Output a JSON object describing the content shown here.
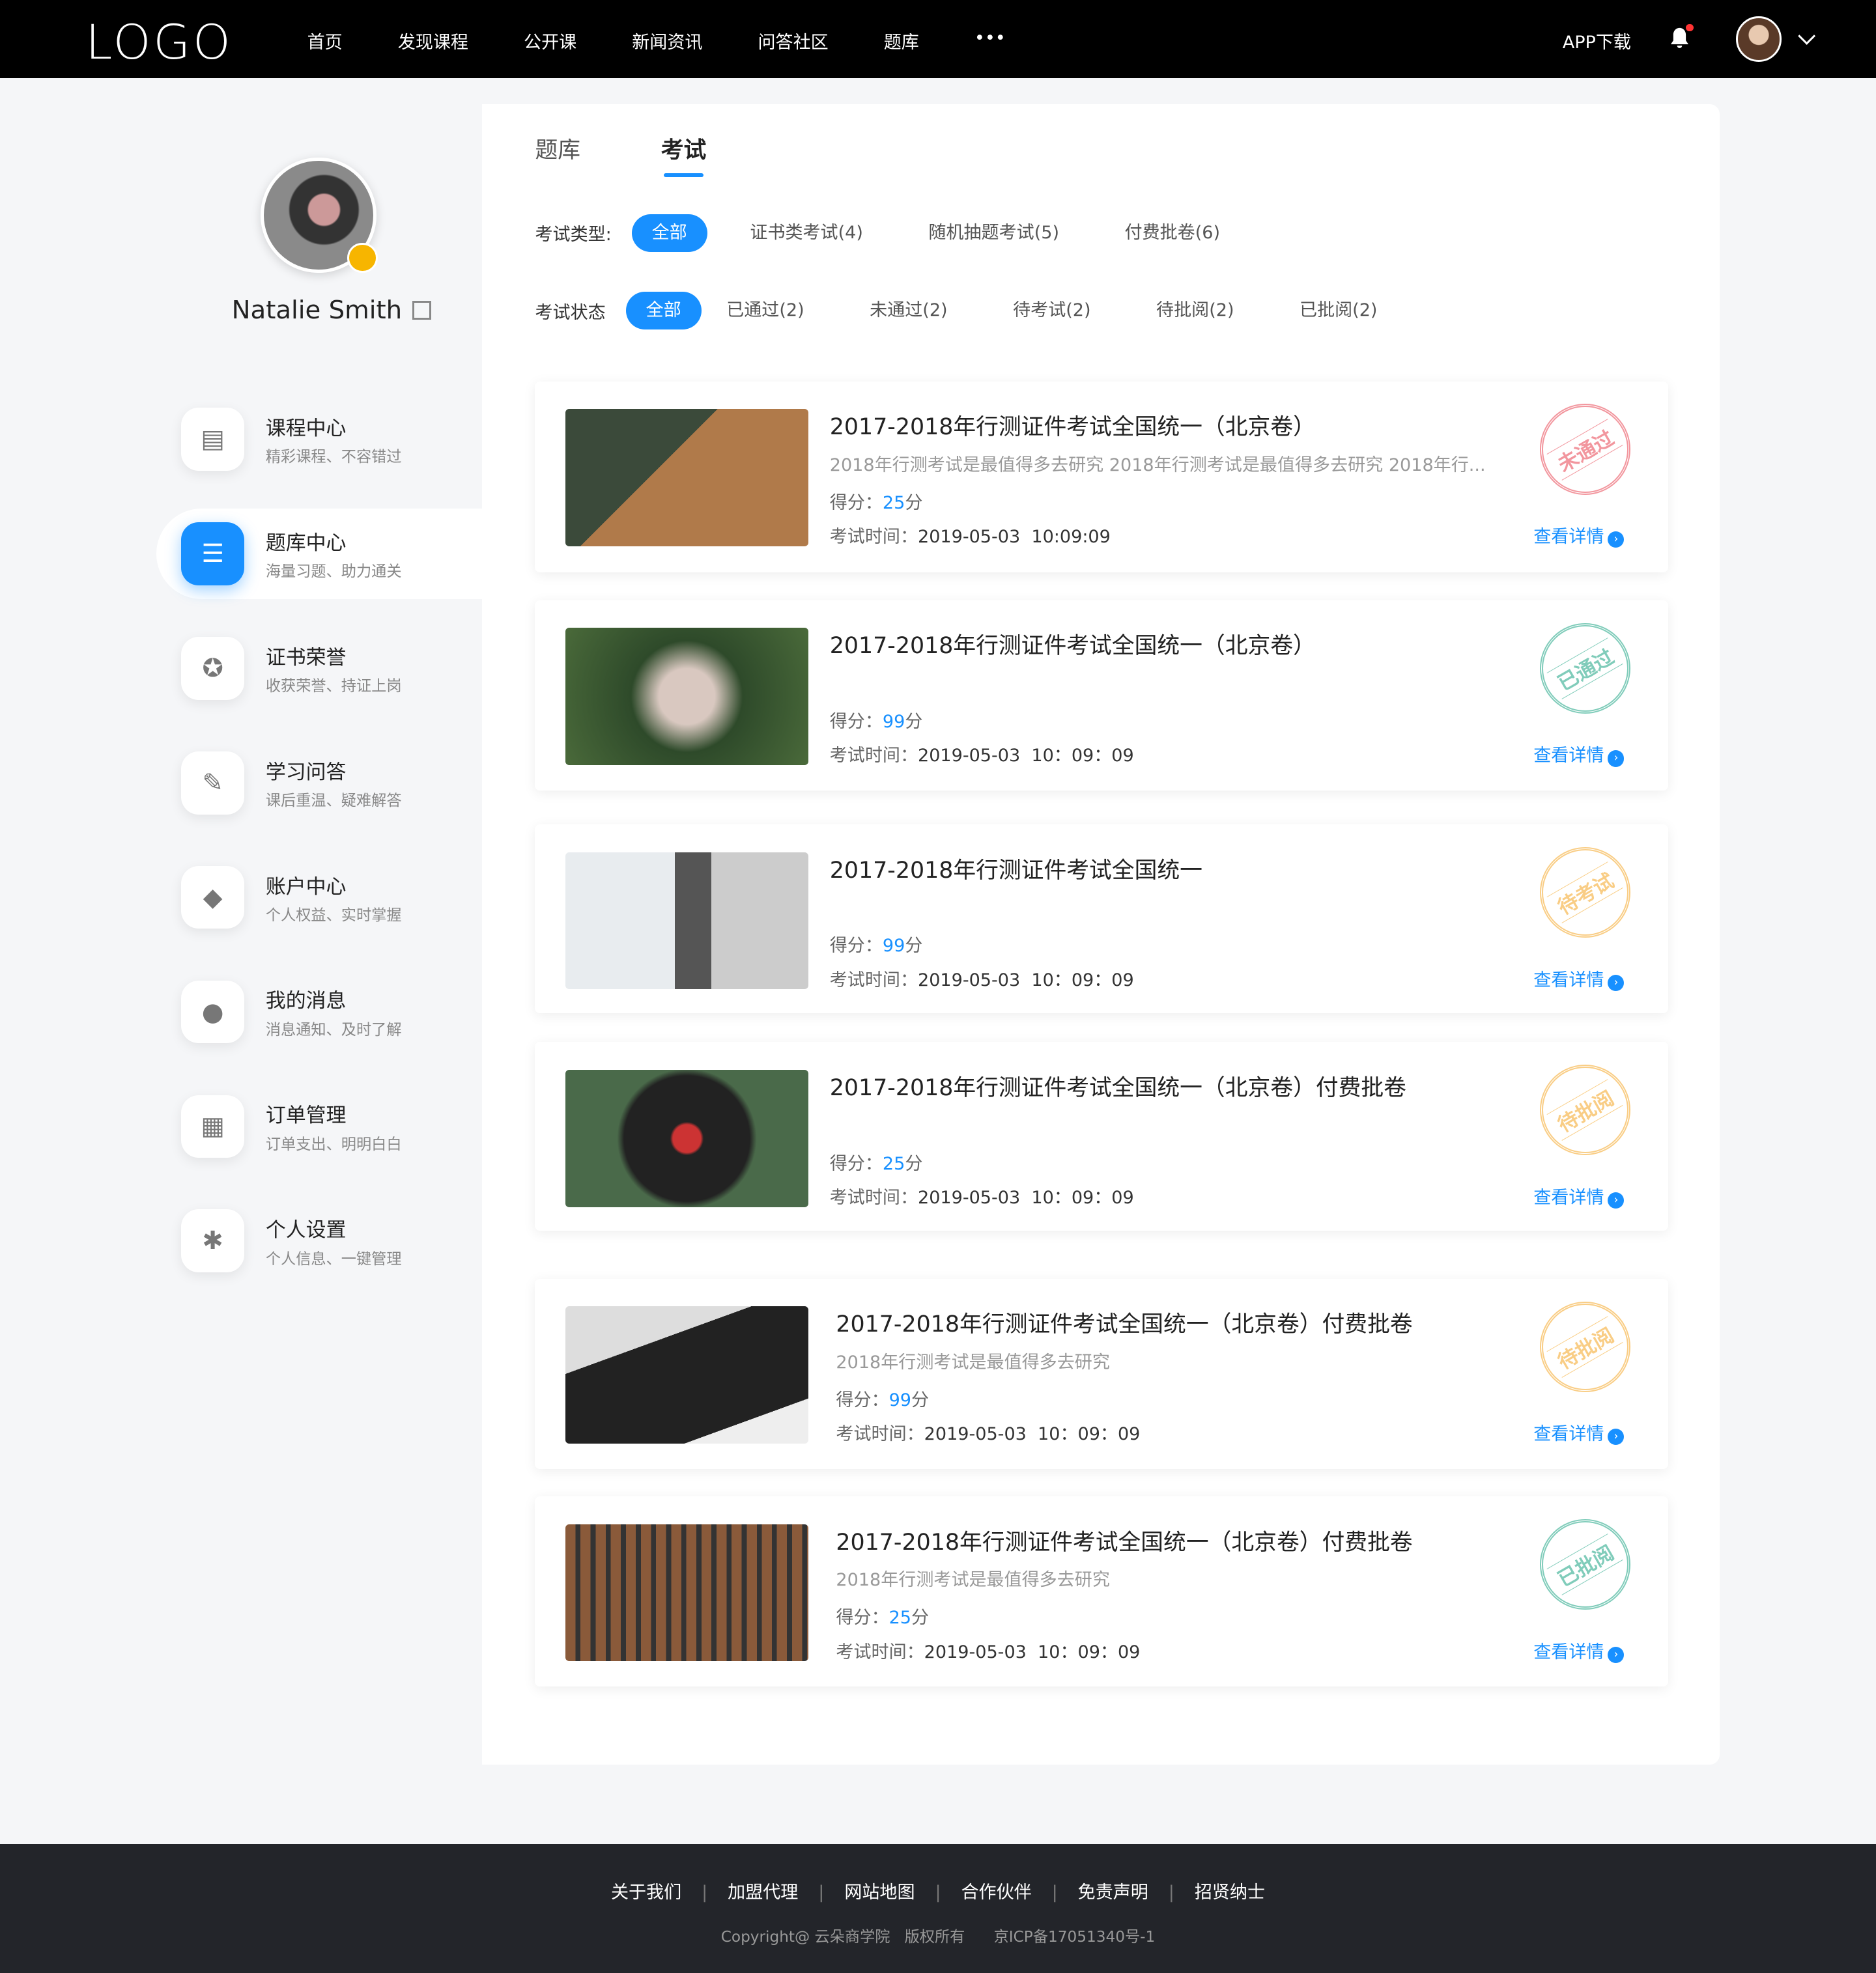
{
  "header": {
    "logo": "LOGO",
    "nav": [
      "首页",
      "发现课程",
      "公开课",
      "新闻资讯",
      "问答社区",
      "题库",
      "•••"
    ],
    "app_download": "APP下载"
  },
  "profile": {
    "name": "Natalie Smith"
  },
  "sidebar": {
    "items": [
      {
        "title": "课程中心",
        "sub": "精彩课程、不容错过",
        "icon": "calendar-icon"
      },
      {
        "title": "题库中心",
        "sub": "海量习题、助力通关",
        "icon": "list-icon",
        "active": true
      },
      {
        "title": "证书荣誉",
        "sub": "收获荣誉、持证上岗",
        "icon": "award-icon"
      },
      {
        "title": "学习问答",
        "sub": "课后重温、疑难解答",
        "icon": "qa-icon"
      },
      {
        "title": "账户中心",
        "sub": "个人权益、实时掌握",
        "icon": "diamond-icon"
      },
      {
        "title": "我的消息",
        "sub": "消息通知、及时了解",
        "icon": "message-icon"
      },
      {
        "title": "订单管理",
        "sub": "订单支出、明明白白",
        "icon": "document-icon"
      },
      {
        "title": "个人设置",
        "sub": "个人信息、一键管理",
        "icon": "gear-icon"
      }
    ]
  },
  "tabs": [
    "题库",
    "考试"
  ],
  "filters": {
    "type_label": "考试类型:",
    "types": [
      "全部",
      "证书类考试(4)",
      "随机抽题考试(5)",
      "付费批卷(6)"
    ],
    "status_label": "考试状态",
    "statuses": [
      "全部",
      "已通过(2)",
      "未通过(2)",
      "待考试(2)",
      "待批阅(2)",
      "已批阅(2)"
    ]
  },
  "exams": [
    {
      "title": "2017-2018年行测证件考试全国统一（北京卷）",
      "desc": "2018年行测考试是最值得多去研究 2018年行测考试是最值得多去研究 2018年行...",
      "score_label": "得分：",
      "score": "25",
      "unit": "分",
      "time_label": "考试时间：",
      "time": "2019-05-03  10:09:09",
      "stamp": "未通过",
      "stamp_color": "#e8424f",
      "more": "查看详情"
    },
    {
      "title": "2017-2018年行测证件考试全国统一（北京卷）",
      "desc": "",
      "score_label": "得分：",
      "score": "99",
      "unit": "分",
      "time_label": "考试时间：",
      "time": "2019-05-03  10：09：09",
      "stamp": "已通过",
      "stamp_color": "#1aa382",
      "more": "查看详情"
    },
    {
      "title": "2017-2018年行测证件考试全国统一",
      "desc": "",
      "score_label": "得分：",
      "score": "99",
      "unit": "分",
      "time_label": "考试时间：",
      "time": "2019-05-03  10：09：09",
      "stamp": "待考试",
      "stamp_color": "#f5a623",
      "more": "查看详情"
    },
    {
      "title": "2017-2018年行测证件考试全国统一（北京卷）付费批卷",
      "desc": "",
      "score_label": "得分：",
      "score": "25",
      "unit": "分",
      "time_label": "考试时间：",
      "time": "2019-05-03  10：09：09",
      "stamp": "待批阅",
      "stamp_color": "#f5a623",
      "more": "查看详情"
    },
    {
      "title": "2017-2018年行测证件考试全国统一（北京卷）付费批卷",
      "desc": "2018年行测考试是最值得多去研究",
      "score_label": "得分：",
      "score": "99",
      "unit": "分",
      "time_label": "考试时间：",
      "time": "2019-05-03  10：09：09",
      "stamp": "待批阅",
      "stamp_color": "#f5a623",
      "more": "查看详情"
    },
    {
      "title": "2017-2018年行测证件考试全国统一（北京卷）付费批卷",
      "desc": "2018年行测考试是最值得多去研究",
      "score_label": "得分：",
      "score": "25",
      "unit": "分",
      "time_label": "考试时间：",
      "time": "2019-05-03  10：09：09",
      "stamp": "已批阅",
      "stamp_color": "#1aa382",
      "more": "查看详情"
    }
  ],
  "footer": {
    "links": [
      "关于我们",
      "加盟代理",
      "网站地图",
      "合作伙伴",
      "免责声明",
      "招贤纳士"
    ],
    "copyright": "Copyright@ 云朵商学院   版权所有      京ICP备17051340号-1"
  },
  "colors": {
    "accent": "#1890ff",
    "header_bg": "#000000",
    "footer_bg": "#23252a"
  }
}
